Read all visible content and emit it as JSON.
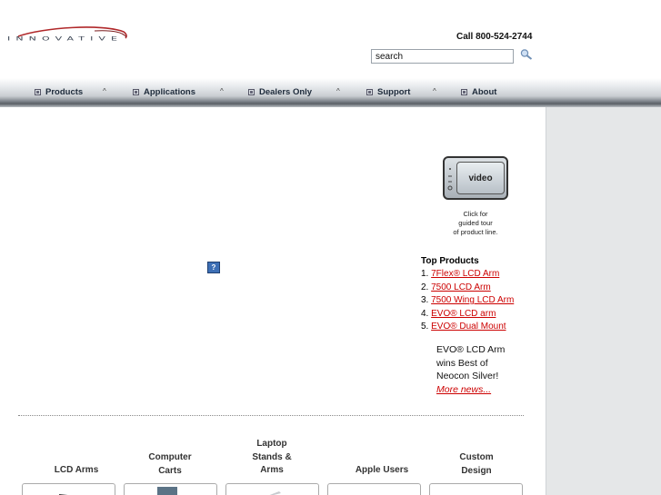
{
  "header": {
    "logo_text": "INNOVATIVE",
    "phone": "Call 800-524-2744",
    "search_value": "search"
  },
  "nav": {
    "items": [
      {
        "label": "Products"
      },
      {
        "label": "Applications"
      },
      {
        "label": "Dealers Only"
      },
      {
        "label": "Support"
      },
      {
        "label": "About"
      }
    ],
    "separator": "^"
  },
  "video": {
    "label": "video",
    "caption_lines": [
      "Click for",
      "guided tour",
      "of product line."
    ]
  },
  "help_icon": "?",
  "top_products": {
    "title": "Top Products",
    "items": [
      {
        "num": "1.",
        "label": "7Flex® LCD Arm"
      },
      {
        "num": "2.",
        "label": "7500 LCD Arm"
      },
      {
        "num": "3.",
        "label": "7500 Wing LCD Arm"
      },
      {
        "num": "4.",
        "label": "EVO® LCD arm"
      },
      {
        "num": "5.",
        "label": "EVO® Dual Mount"
      }
    ]
  },
  "news": {
    "text": "EVO® LCD Arm wins Best of Neocon Silver!",
    "more_link": "More news..."
  },
  "categories": [
    {
      "lines": [
        "LCD Arms"
      ]
    },
    {
      "lines": [
        "Computer",
        "Carts"
      ]
    },
    {
      "lines": [
        "Laptop",
        "Stands &",
        "Arms"
      ]
    },
    {
      "lines": [
        "Apple Users"
      ]
    },
    {
      "lines": [
        "Custom",
        "Design"
      ]
    }
  ],
  "colors": {
    "link": "#cc0000",
    "right_panel": "#e5e7e8",
    "nav_text": "#1d2a3a"
  }
}
